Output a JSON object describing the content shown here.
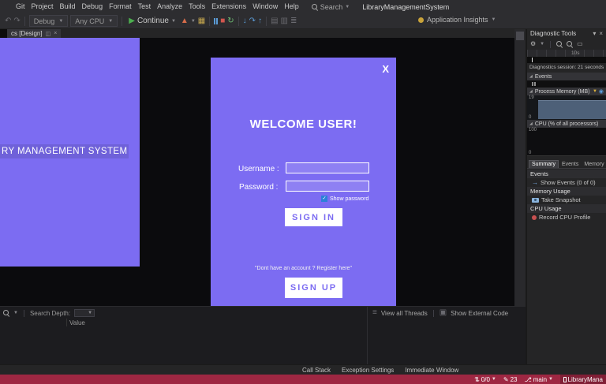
{
  "colors": {
    "accent": "#7c6cf2",
    "statusbar": "#9e2742",
    "panel": "#252526",
    "chrome": "#2d2d30",
    "editor": "#0b0b0d",
    "memory_fill": "#4d6078"
  },
  "menu": {
    "items": [
      "Git",
      "Project",
      "Build",
      "Debug",
      "Format",
      "Test",
      "Analyze",
      "Tools",
      "Extensions",
      "Window",
      "Help"
    ],
    "search_label": "Search",
    "window_title": "LibraryManagementSystem"
  },
  "toolbar": {
    "config": "Debug",
    "platform": "Any CPU",
    "continue_label": "Continue",
    "insights_label": "Application Insights"
  },
  "tabs": {
    "design_tab": "cs [Design]"
  },
  "designer": {
    "left_window_title": "RY MANAGEMENT SYSTEM"
  },
  "dialog": {
    "close_label": "X",
    "title": "WELCOME USER!",
    "username_label": "Username :",
    "password_label": "Password :",
    "show_password_label": "Show password",
    "sign_in_label": "SIGN IN",
    "register_hint": "\"Dont have an account ? Register here\"",
    "sign_up_label": "SIGN UP"
  },
  "diagnostics": {
    "panel_title": "Diagnostic Tools",
    "ruler_label": "10s",
    "session_label": "Diagnostics session: 21 seconds",
    "events_section": "Events",
    "memory_section": "Process Memory (MB)",
    "memory_scale_max": "19",
    "memory_scale_min": "0",
    "cpu_section": "CPU (% of all processors)",
    "cpu_scale_max": "100",
    "cpu_scale_min": "0",
    "tabs": [
      "Summary",
      "Events",
      "Memory Usage"
    ],
    "summary": {
      "events_header": "Events",
      "show_events": "Show Events (0 of 0)",
      "memory_header": "Memory Usage",
      "take_snapshot": "Take Snapshot",
      "cpu_header": "CPU Usage",
      "record_cpu": "Record CPU Profile"
    }
  },
  "watch": {
    "search_depth_label": "Search Depth:",
    "value_column": "Value"
  },
  "callstack": {
    "view_all_threads": "View all Threads",
    "show_external_code": "Show External Code"
  },
  "bottom_tabs": [
    "Call Stack",
    "Exception Settings",
    "Immediate Window"
  ],
  "statusbar": {
    "sync_count": "0/0",
    "pending_changes": "23",
    "branch": "main",
    "repo": "LibraryMana"
  }
}
